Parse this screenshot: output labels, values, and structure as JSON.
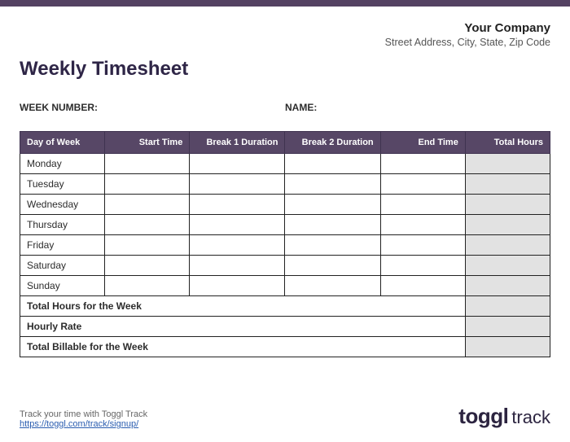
{
  "company": {
    "name": "Your Company",
    "address": "Street Address, City, State, Zip Code"
  },
  "title": "Weekly Timesheet",
  "meta": {
    "week_label": "WEEK NUMBER:",
    "week_value": "",
    "name_label": "NAME:",
    "name_value": ""
  },
  "table": {
    "headers": {
      "day": "Day of Week",
      "start": "Start Time",
      "break1": "Break 1 Duration",
      "break2": "Break 2 Duration",
      "end": "End Time",
      "total": "Total Hours"
    },
    "rows": [
      {
        "day": "Monday",
        "start": "",
        "break1": "",
        "break2": "",
        "end": "",
        "total": ""
      },
      {
        "day": "Tuesday",
        "start": "",
        "break1": "",
        "break2": "",
        "end": "",
        "total": ""
      },
      {
        "day": "Wednesday",
        "start": "",
        "break1": "",
        "break2": "",
        "end": "",
        "total": ""
      },
      {
        "day": "Thursday",
        "start": "",
        "break1": "",
        "break2": "",
        "end": "",
        "total": ""
      },
      {
        "day": "Friday",
        "start": "",
        "break1": "",
        "break2": "",
        "end": "",
        "total": ""
      },
      {
        "day": "Saturday",
        "start": "",
        "break1": "",
        "break2": "",
        "end": "",
        "total": ""
      },
      {
        "day": "Sunday",
        "start": "",
        "break1": "",
        "break2": "",
        "end": "",
        "total": ""
      }
    ],
    "summary": {
      "total_hours_label": "Total Hours for the Week",
      "total_hours_value": "",
      "hourly_rate_label": "Hourly Rate",
      "hourly_rate_value": "",
      "total_billable_label": "Total Billable for the Week",
      "total_billable_value": ""
    }
  },
  "footer": {
    "note": "Track your time with Toggl Track",
    "link_text": "https://toggl.com/track/signup/",
    "logo_bold": "toggl",
    "logo_light": "track"
  }
}
